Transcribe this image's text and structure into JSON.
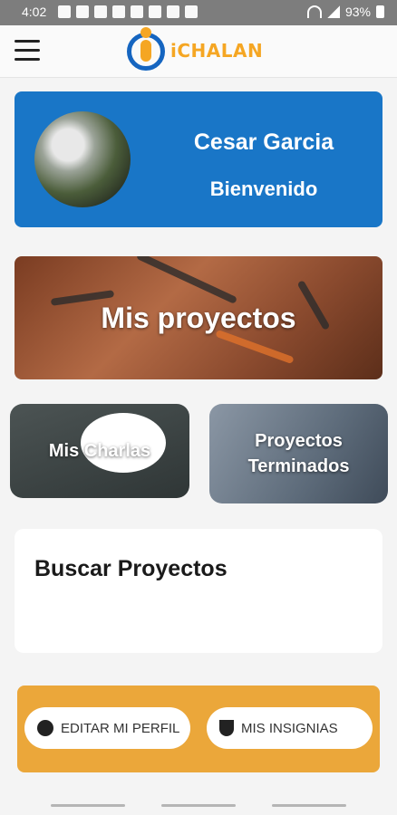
{
  "status_bar": {
    "time": "4:02",
    "battery": "93%"
  },
  "app_bar": {
    "logo_text": "iCHALAN"
  },
  "profile": {
    "name": "Cesar Garcia",
    "greeting": "Bienvenido"
  },
  "cards": {
    "projects": "Mis proyectos",
    "chats": "Mis Charlas",
    "finished": "Proyectos Terminados"
  },
  "search": {
    "title": "Buscar Proyectos"
  },
  "actions": {
    "edit_profile": "EDITAR MI PERFIL",
    "badges": "MIS INSIGNIAS"
  },
  "colors": {
    "primary": "#1976c7",
    "accent": "#eba73a"
  }
}
